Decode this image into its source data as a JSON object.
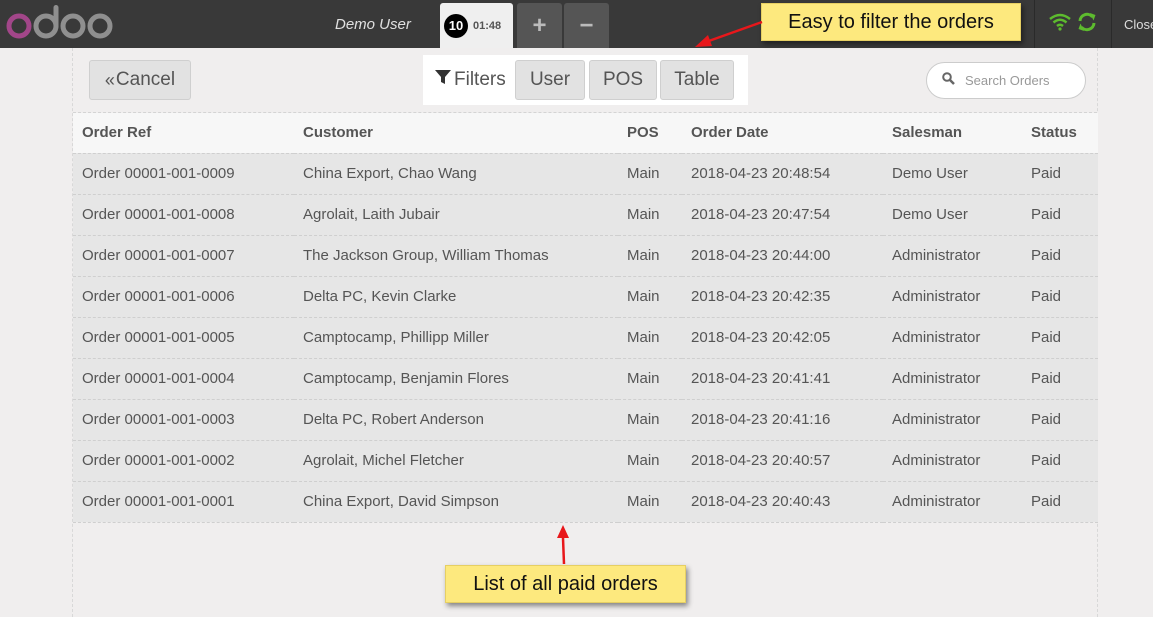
{
  "topbar": {
    "logo_text": "odoo",
    "user_name": "Demo User",
    "order_tab": {
      "number": "10",
      "time": "01:48"
    },
    "add_order_icon": "plus-icon",
    "remove_order_icon": "minus-icon",
    "status_icons": [
      "wifi-icon",
      "sync-icon"
    ],
    "close_label": "Close"
  },
  "controls": {
    "cancel_label": "Cancel",
    "filters_label": "Filters",
    "filter_buttons": [
      "User",
      "POS",
      "Table"
    ],
    "search_placeholder": "Search Orders"
  },
  "table": {
    "columns": [
      "Order Ref",
      "Customer",
      "POS",
      "Order Date",
      "Salesman",
      "Status"
    ],
    "rows": [
      [
        "Order 00001-001-0009",
        "China Export, Chao Wang",
        "Main",
        "2018-04-23 20:48:54",
        "Demo User",
        "Paid"
      ],
      [
        "Order 00001-001-0008",
        "Agrolait, Laith Jubair",
        "Main",
        "2018-04-23 20:47:54",
        "Demo User",
        "Paid"
      ],
      [
        "Order 00001-001-0007",
        "The Jackson Group, William Thomas",
        "Main",
        "2018-04-23 20:44:00",
        "Administrator",
        "Paid"
      ],
      [
        "Order 00001-001-0006",
        "Delta PC, Kevin Clarke",
        "Main",
        "2018-04-23 20:42:35",
        "Administrator",
        "Paid"
      ],
      [
        "Order 00001-001-0005",
        "Camptocamp, Phillipp Miller",
        "Main",
        "2018-04-23 20:42:05",
        "Administrator",
        "Paid"
      ],
      [
        "Order 00001-001-0004",
        "Camptocamp, Benjamin Flores",
        "Main",
        "2018-04-23 20:41:41",
        "Administrator",
        "Paid"
      ],
      [
        "Order 00001-001-0003",
        "Delta PC, Robert Anderson",
        "Main",
        "2018-04-23 20:41:16",
        "Administrator",
        "Paid"
      ],
      [
        "Order 00001-001-0002",
        "Agrolait, Michel Fletcher",
        "Main",
        "2018-04-23 20:40:57",
        "Administrator",
        "Paid"
      ],
      [
        "Order 00001-001-0001",
        "China Export, David Simpson",
        "Main",
        "2018-04-23 20:40:43",
        "Administrator",
        "Paid"
      ]
    ]
  },
  "annotations": {
    "filter_note": "Easy to filter the orders",
    "list_note": "List of all paid orders"
  },
  "colors": {
    "topbar": "#393939",
    "logo_accent": "#a24689",
    "logo_gray": "#8f8f8f",
    "status_green": "#5dbb2e",
    "note_yellow": "#fde97e",
    "arrow_red": "#e8171b"
  }
}
